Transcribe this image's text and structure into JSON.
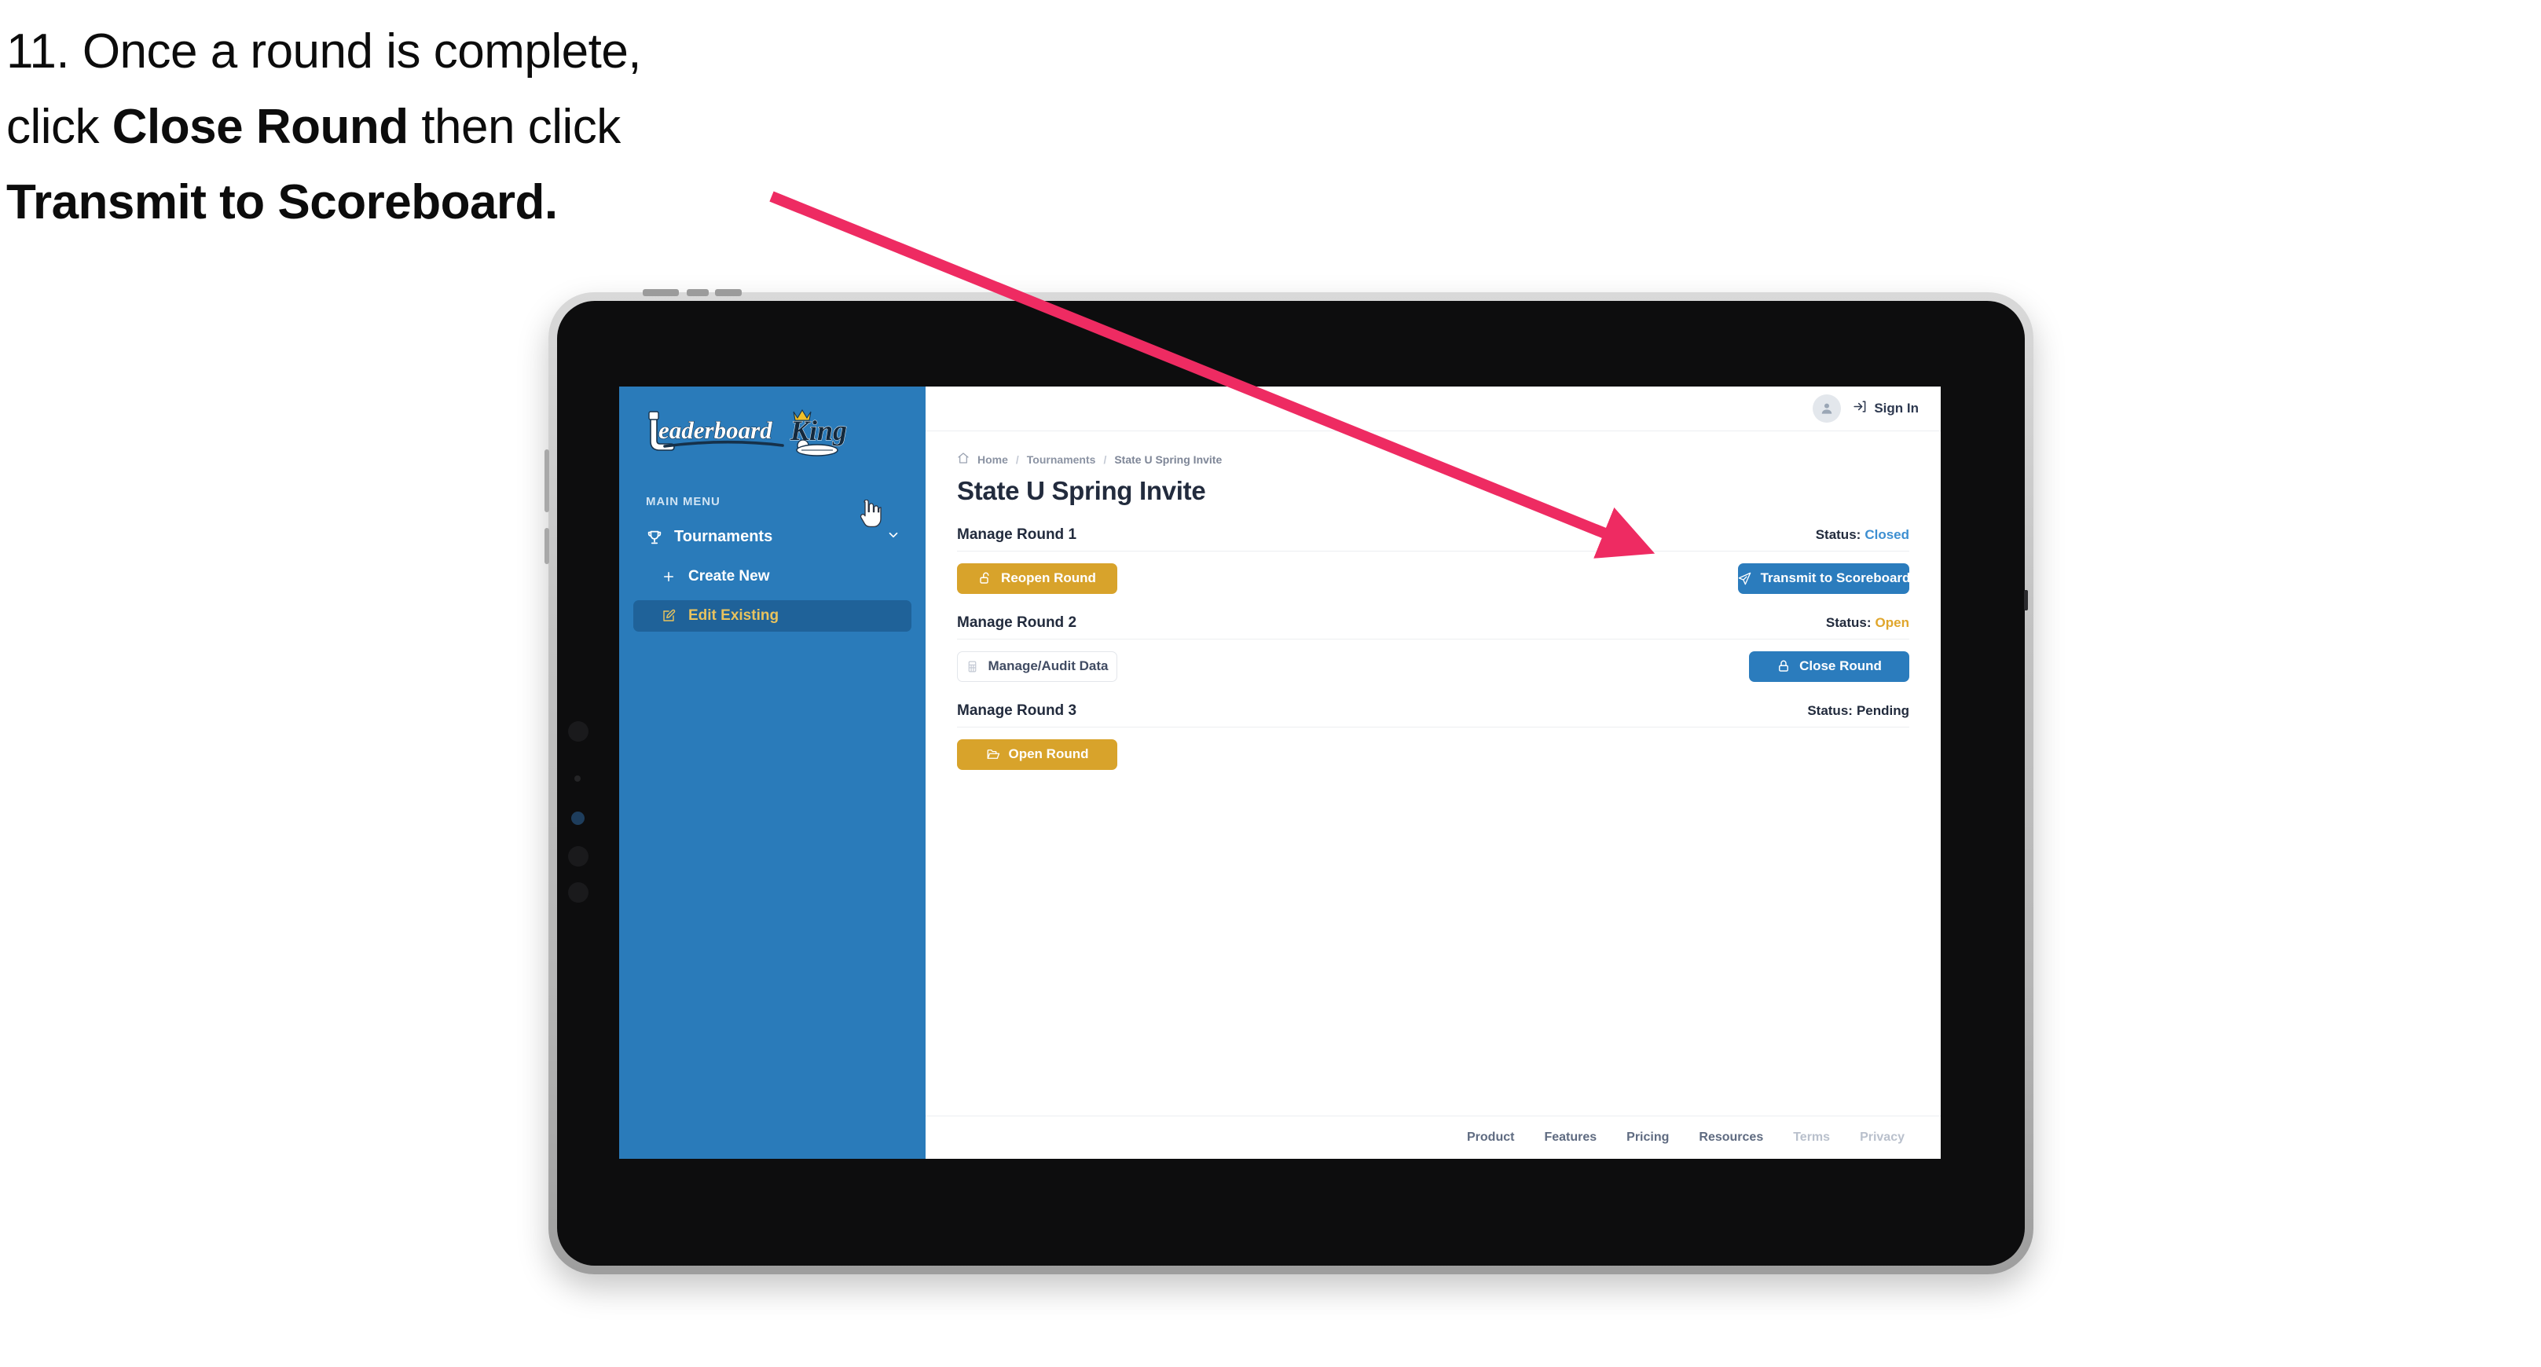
{
  "caption": {
    "line1_plain": "11. Once a round is complete,",
    "line2_plain_a": "click ",
    "line2_bold": "Close Round",
    "line2_plain_b": " then click",
    "line3_bold": "Transmit to Scoreboard."
  },
  "colors": {
    "sidebar_blue": "#2A7BBA",
    "sidebar_active": "#1F6299",
    "accent_gold": "#D8A32B",
    "button_blue": "#2B7CBD",
    "status_closed": "#3D8FD1",
    "status_open": "#E0A62C",
    "status_pending": "#222B3D",
    "annotation_pink": "#EE2B62",
    "text_dark": "#222B3D"
  },
  "sidebar": {
    "logo_text_primary": "Leaderboard",
    "logo_text_secondary": "King",
    "section_label": "MAIN MENU",
    "items": [
      {
        "label": "Tournaments",
        "icon": "trophy-icon",
        "chevron": "chevron-down-icon",
        "active": false
      },
      {
        "label": "Create New",
        "icon": "plus-icon",
        "active": false
      },
      {
        "label": "Edit Existing",
        "icon": "edit-square-icon",
        "active": true
      }
    ]
  },
  "topbar": {
    "avatar_icon": "user-avatar-icon",
    "signin_icon": "login-arrow-icon",
    "signin_label": "Sign In"
  },
  "breadcrumb": {
    "home_icon": "home-icon",
    "items": [
      "Home",
      "Tournaments",
      "State U Spring Invite"
    ],
    "separator": "/"
  },
  "page": {
    "title": "State U Spring Invite"
  },
  "rounds": [
    {
      "title": "Manage Round 1",
      "status_label": "Status:",
      "status_value": "Closed",
      "status_key": "closed",
      "left_button": {
        "label": "Reopen Round",
        "icon": "unlock-icon",
        "style": "gold"
      },
      "right_button": {
        "label": "Transmit to Scoreboard",
        "icon": "paper-plane-icon",
        "style": "blue"
      }
    },
    {
      "title": "Manage Round 2",
      "status_label": "Status:",
      "status_value": "Open",
      "status_key": "open",
      "left_button": {
        "label": "Manage/Audit Data",
        "icon": "table-grid-icon",
        "style": "ghost"
      },
      "right_button": {
        "label": "Close Round",
        "icon": "lock-icon",
        "style": "blue"
      }
    },
    {
      "title": "Manage Round 3",
      "status_label": "Status:",
      "status_value": "Pending",
      "status_key": "pending",
      "left_button": {
        "label": "Open Round",
        "icon": "folder-open-icon",
        "style": "gold"
      },
      "right_button": null
    }
  ],
  "footer": {
    "links": [
      {
        "label": "Product",
        "muted": false
      },
      {
        "label": "Features",
        "muted": false
      },
      {
        "label": "Pricing",
        "muted": false
      },
      {
        "label": "Resources",
        "muted": false
      },
      {
        "label": "Terms",
        "muted": true
      },
      {
        "label": "Privacy",
        "muted": true
      }
    ]
  },
  "annotation": {
    "type": "arrow",
    "points_to": "transmit-to-scoreboard-button"
  }
}
